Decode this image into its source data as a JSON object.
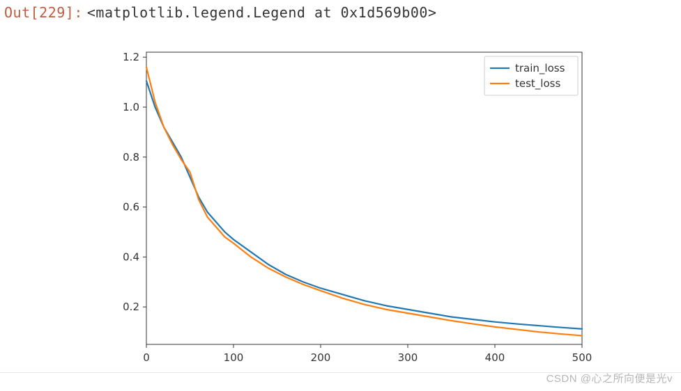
{
  "prompt": {
    "label": "Out[229]:"
  },
  "repr_text": "<matplotlib.legend.Legend at 0x1d569b00>",
  "watermark": "CSDN @心之所向便是光v",
  "chart_data": {
    "type": "line",
    "title": "",
    "xlabel": "",
    "ylabel": "",
    "xlim": [
      0,
      500
    ],
    "ylim": [
      0.05,
      1.22
    ],
    "x_ticks": [
      0,
      100,
      200,
      300,
      400,
      500
    ],
    "y_ticks": [
      0.2,
      0.4,
      0.6,
      0.8,
      1.0,
      1.2
    ],
    "legend": {
      "position": "upper right",
      "entries": [
        "train_loss",
        "test_loss"
      ]
    },
    "colors": {
      "train_loss": "#1f77b4",
      "test_loss": "#ff7f0e"
    },
    "x": [
      0,
      10,
      20,
      30,
      40,
      50,
      60,
      70,
      80,
      90,
      100,
      120,
      140,
      160,
      180,
      200,
      225,
      250,
      275,
      300,
      325,
      350,
      375,
      400,
      425,
      450,
      475,
      500
    ],
    "series": [
      {
        "name": "train_loss",
        "values": [
          1.105,
          1.0,
          0.92,
          0.86,
          0.8,
          0.72,
          0.64,
          0.58,
          0.54,
          0.5,
          0.47,
          0.42,
          0.37,
          0.33,
          0.3,
          0.275,
          0.25,
          0.225,
          0.205,
          0.19,
          0.175,
          0.16,
          0.15,
          0.14,
          0.132,
          0.125,
          0.118,
          0.112
        ]
      },
      {
        "name": "test_loss",
        "values": [
          1.16,
          1.02,
          0.92,
          0.85,
          0.79,
          0.74,
          0.63,
          0.56,
          0.52,
          0.48,
          0.455,
          0.4,
          0.355,
          0.32,
          0.29,
          0.265,
          0.235,
          0.21,
          0.19,
          0.175,
          0.16,
          0.145,
          0.132,
          0.12,
          0.11,
          0.1,
          0.092,
          0.085
        ]
      }
    ]
  }
}
